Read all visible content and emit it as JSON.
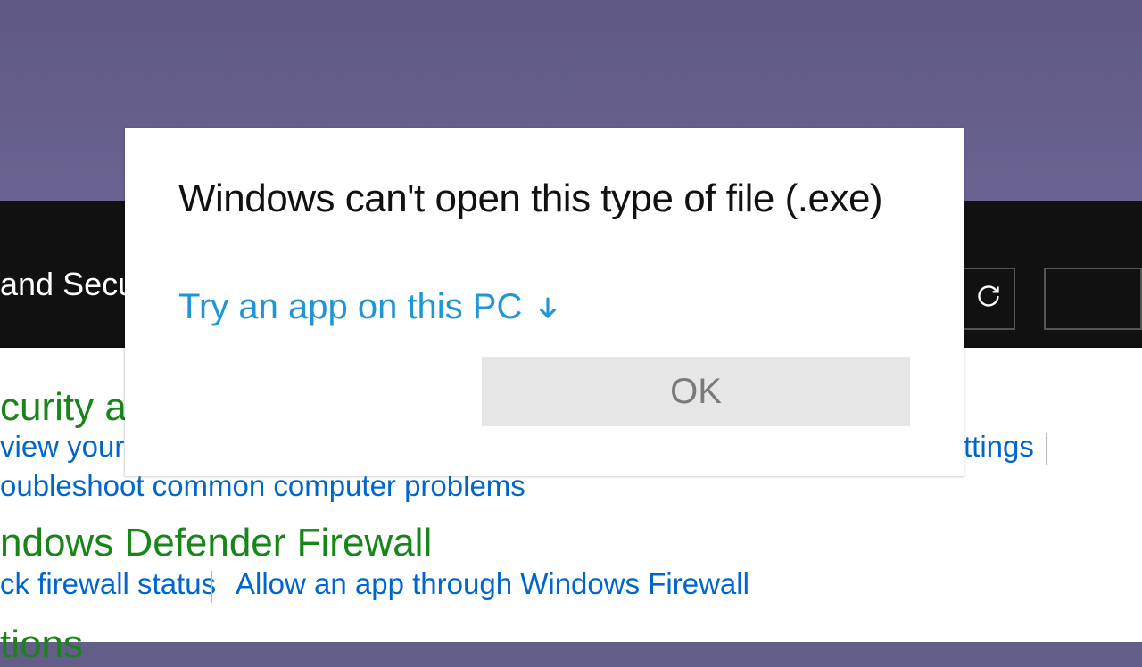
{
  "background": {
    "breadcrumb_fragment": "and Security",
    "sections": [
      {
        "heading_fragment": "curity and",
        "links": [
          "view your co",
          "oubleshoot common computer problems"
        ],
        "right_link_fragment": "ttings"
      },
      {
        "heading_fragment": "ndows Defender Firewall",
        "links": [
          "ck firewall status",
          "Allow an app through Windows Firewall"
        ]
      },
      {
        "heading_fragment": "tions"
      }
    ]
  },
  "dialog": {
    "title": "Windows can't open this type of file (.exe)",
    "expand_link": "Try an app on this PC",
    "ok_label": "OK"
  }
}
